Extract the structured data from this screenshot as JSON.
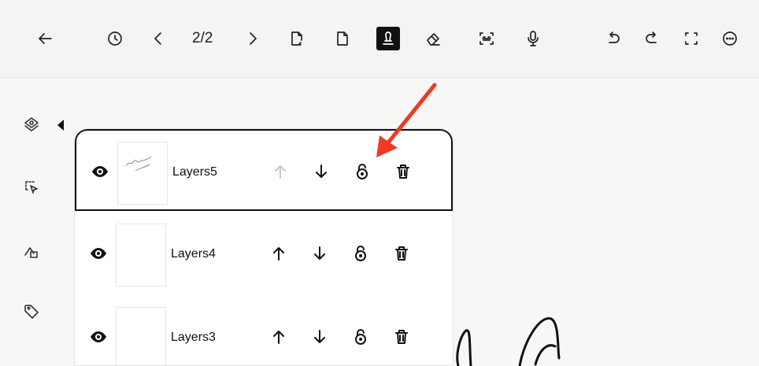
{
  "toolbar": {
    "page_indicator": "2/2",
    "icons": [
      "back-arrow-icon",
      "history-icon",
      "prev-page-icon",
      "next-page-icon",
      "add-page-after-icon",
      "add-page-icon",
      "layers-icon",
      "eraser-icon",
      "ocr-icon",
      "microphone-icon",
      "undo-icon",
      "redo-icon",
      "fullscreen-icon",
      "more-icon"
    ],
    "active": "layers-icon"
  },
  "sidebar": {
    "icons": [
      "layers-stack-icon",
      "lasso-select-icon",
      "shapes-icon",
      "tag-icon"
    ]
  },
  "layers": [
    {
      "name": "Layers5",
      "selected": true,
      "move_up_enabled": false
    },
    {
      "name": "Layers4",
      "selected": false,
      "move_up_enabled": true
    },
    {
      "name": "Layers3",
      "selected": false,
      "move_up_enabled": true
    }
  ],
  "annotation": {
    "arrow_color": "#ef3b24",
    "points_to": "lock-icon"
  }
}
